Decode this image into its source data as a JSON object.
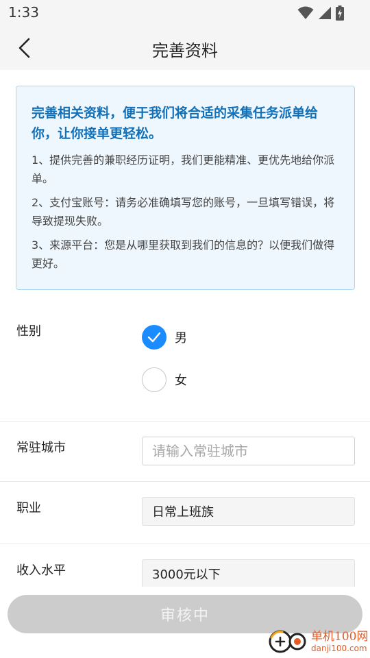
{
  "status_bar": {
    "time": "1:33"
  },
  "nav": {
    "title": "完善资料"
  },
  "info": {
    "title": "完善相关资料，便于我们将合适的采集任务派单给你，让你接单更轻松。",
    "items": [
      "1、提供完善的兼职经历证明，我们更能精准、更优先地给你派单。",
      "2、支付宝账号：请务必准确填写您的账号，一旦填写错误，将导致提现失败。",
      "3、来源平台：您是从哪里获取到我们的信息的？以便我们做得更好。"
    ]
  },
  "form": {
    "gender": {
      "label": "性别",
      "options": [
        "男",
        "女"
      ],
      "selected": "男"
    },
    "city": {
      "label": "常驻城市",
      "placeholder": "请输入常驻城市",
      "value": ""
    },
    "occupation": {
      "label": "职业",
      "value": "日常上班族"
    },
    "income": {
      "label": "收入水平",
      "value": "3000元以下"
    }
  },
  "submit": {
    "label": "审核中"
  },
  "watermark": {
    "main": "单机100网",
    "sub": "danji100.com"
  },
  "colors": {
    "accent": "#1a8cff",
    "info_title": "#1270b8",
    "info_bg": "#eef7fd",
    "button_disabled": "#cccccc"
  }
}
